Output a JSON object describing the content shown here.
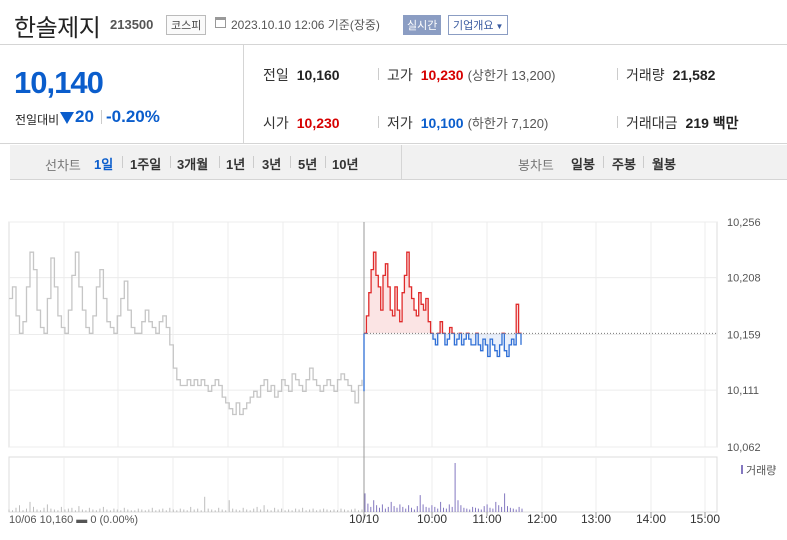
{
  "header": {
    "name": "한솔제지",
    "code": "213500",
    "market": "코스피",
    "datetime": "2023.10.10 12:06 기준(장중)",
    "realtime": "실시간",
    "company_overview": "기업개요"
  },
  "price": {
    "current": "10,140",
    "change_label": "전일대비",
    "change": "20",
    "change_rate": "-0.20%"
  },
  "stats": {
    "prev_close_label": "전일",
    "prev_close": "10,160",
    "high_label": "고가",
    "high": "10,230",
    "upper_limit": "(상한가 13,200)",
    "volume_label": "거래량",
    "volume": "21,582",
    "open_label": "시가",
    "open": "10,230",
    "low_label": "저가",
    "low": "10,100",
    "lower_limit": "(하한가 7,120)",
    "trade_value_label": "거래대금",
    "trade_value": "219 백만"
  },
  "period_tabs": {
    "line_title": "선차트",
    "line": [
      "1일",
      "1주일",
      "3개월",
      "1년",
      "3년",
      "5년",
      "10년"
    ],
    "candle_title": "봉차트",
    "candle": [
      "일봉",
      "주봉",
      "월봉"
    ],
    "active": "1일"
  },
  "colors": {
    "up": "#e02b2b",
    "down": "#2f6fd6",
    "prev_day": "#c6c6c6",
    "accent": "#0a5dcc",
    "volume_bar": "#8478c0"
  },
  "chart_data": {
    "type": "line",
    "ylim": [
      10062,
      10256
    ],
    "y_ticks": [
      "10,256",
      "10,208",
      "10,159",
      "10,111",
      "10,062"
    ],
    "baseline": 10160,
    "x_ticks": [
      "10/10",
      "10:00",
      "11:00",
      "12:00",
      "13:00",
      "14:00",
      "15:00"
    ],
    "prev_day_label": "10/06 10,160 ▬ 0 (0.00%)",
    "volume_label": "거래량",
    "series": [
      {
        "values": [
          10190,
          10200,
          10175,
          10160,
          10170,
          10200,
          10230,
          10215,
          10180,
          10165,
          10160,
          10190,
          10225,
          10200,
          10175,
          10165,
          10160,
          10180,
          10210,
          10230,
          10200,
          10180,
          10165,
          10160,
          10175,
          10200,
          10215,
          10190,
          10170,
          10165,
          10160,
          10175,
          10190,
          10205,
          10180,
          10165,
          10160,
          10160,
          10170,
          10180,
          10170,
          10165,
          10160,
          10170,
          10175,
          10165,
          10150,
          10130,
          10120,
          10115,
          10115,
          10120,
          10115,
          10120,
          10115,
          10120,
          10115,
          10110,
          10115,
          10120,
          10115,
          10105,
          10100,
          10095,
          10090,
          10100,
          10090,
          10095,
          10100,
          10105,
          10110,
          10105,
          10115,
          10120,
          10110,
          10115,
          10105,
          10110,
          10120,
          10115,
          10110,
          10125,
          10120,
          10115,
          10110,
          10120,
          10130,
          10120,
          10115,
          10110,
          10115,
          10120,
          10115,
          10110,
          10120,
          10125,
          10120,
          10115,
          10110,
          10100,
          10115,
          10120
        ]
      },
      {
        "values": [
          10160,
          10175,
          10195,
          10215,
          10230,
          10210,
          10200,
          10180,
          10210,
          10220,
          10200,
          10180,
          10175,
          10200,
          10180,
          10170,
          10195,
          10210,
          10230,
          10200,
          10190,
          10180,
          10175,
          10195,
          10185,
          10180,
          10190,
          10170,
          10160,
          10155,
          10150,
          10160,
          10170,
          10160,
          10150,
          10155,
          10165,
          10160,
          10150,
          10155,
          10160,
          10150,
          10155,
          10160,
          10155,
          10150,
          10150,
          10160,
          10150,
          10145,
          10155,
          10150,
          10140,
          10155,
          10150,
          10145,
          10140,
          10150,
          10160,
          10145,
          10140,
          10150,
          10155,
          10150,
          10185,
          10160,
          10150
        ]
      }
    ],
    "volume": [
      3,
      2,
      5,
      8,
      2,
      4,
      12,
      6,
      3,
      2,
      5,
      9,
      4,
      3,
      2,
      6,
      3,
      4,
      5,
      2,
      7,
      3,
      2,
      5,
      3,
      2,
      4,
      6,
      3,
      2,
      4,
      3,
      2,
      5,
      3,
      2,
      2,
      4,
      3,
      2,
      3,
      5,
      2,
      3,
      4,
      2,
      5,
      3,
      2,
      4,
      3,
      2,
      6,
      3,
      4,
      2,
      18,
      4,
      3,
      2,
      5,
      3,
      2,
      14,
      4,
      3,
      2,
      5,
      3,
      2,
      4,
      6,
      3,
      8,
      3,
      2,
      5,
      3,
      4,
      2,
      3,
      2,
      4,
      3,
      5,
      2,
      3,
      4,
      2,
      3,
      4,
      3,
      2,
      3,
      2,
      4,
      3,
      2,
      3,
      4,
      2,
      3,
      22,
      10,
      6,
      14,
      8,
      5,
      9,
      4,
      6,
      12,
      7,
      5,
      9,
      6,
      4,
      8,
      5,
      3,
      7,
      20,
      9,
      6,
      5,
      8,
      6,
      4,
      12,
      5,
      4,
      9,
      6,
      58,
      14,
      8,
      5,
      4,
      3,
      6,
      5,
      4,
      3,
      7,
      9,
      5,
      4,
      12,
      8,
      6,
      22,
      7,
      5,
      4,
      3,
      6,
      4
    ]
  }
}
